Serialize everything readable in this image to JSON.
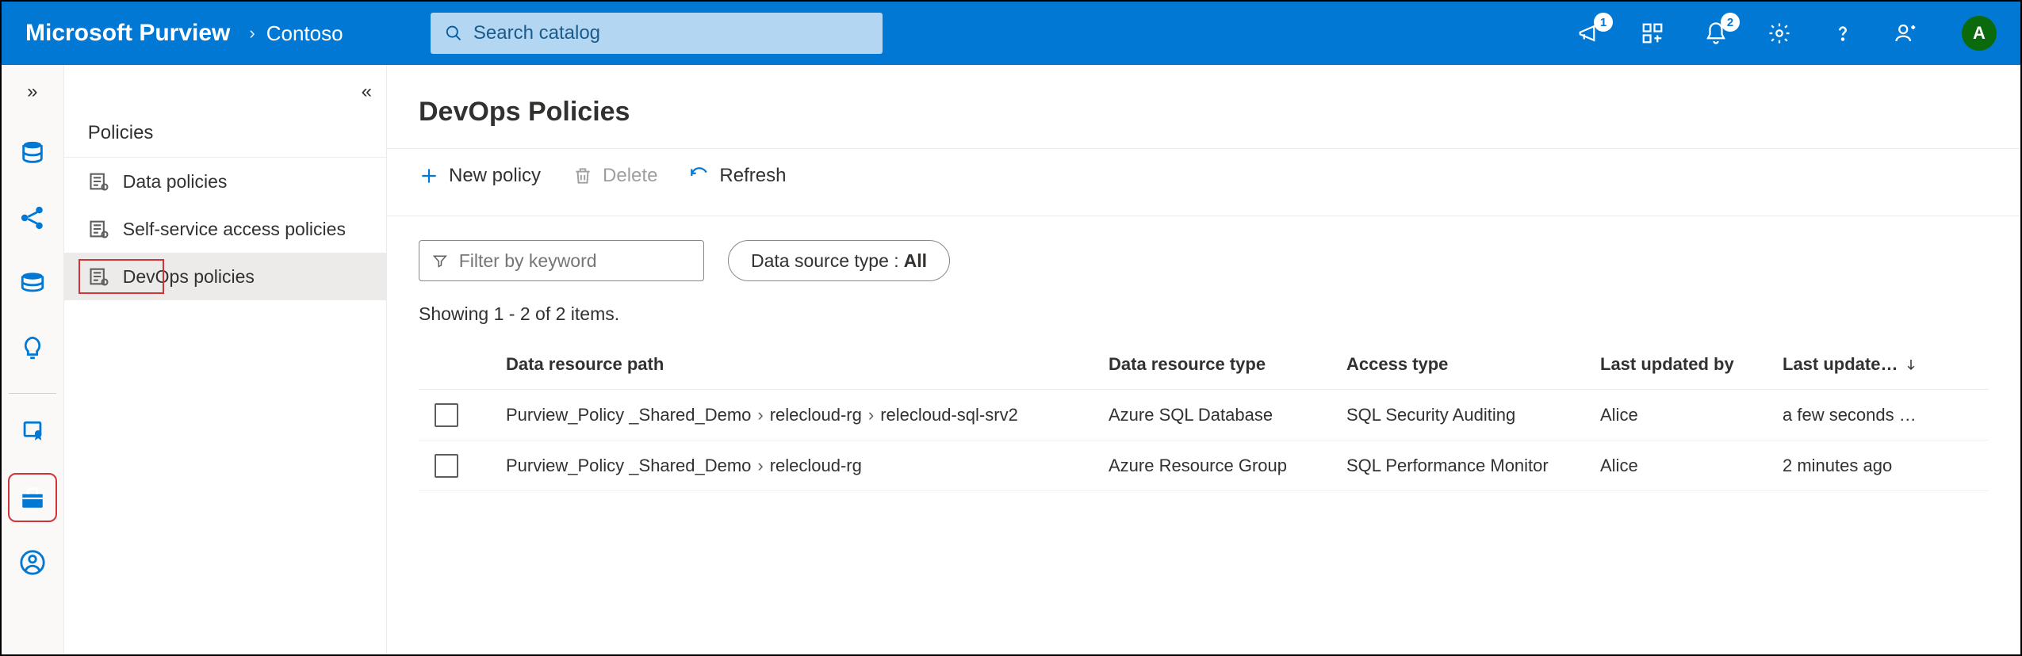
{
  "header": {
    "brand": "Microsoft Purview",
    "crumb": "Contoso",
    "search_placeholder": "Search catalog",
    "badges": {
      "megaphone": "1",
      "bell": "2"
    },
    "avatar_initial": "A"
  },
  "sidepanel": {
    "title": "Policies",
    "items": [
      {
        "label": "Data policies"
      },
      {
        "label": "Self-service access policies"
      },
      {
        "label": "DevOps policies",
        "selected": true
      }
    ]
  },
  "page": {
    "title": "DevOps Policies",
    "toolbar": {
      "new_label": "New policy",
      "delete_label": "Delete",
      "refresh_label": "Refresh"
    },
    "filter_placeholder": "Filter by keyword",
    "datasource_pill_prefix": "Data source type :",
    "datasource_pill_value": "All",
    "count_text": "Showing 1 - 2 of 2 items.",
    "columns": {
      "path": "Data resource path",
      "type": "Data resource type",
      "access": "Access type",
      "updated_by": "Last updated by",
      "updated_on": "Last update…"
    },
    "rows": [
      {
        "path_parts": [
          "Purview_Policy _Shared_Demo",
          "relecloud-rg",
          "relecloud-sql-srv2"
        ],
        "type": "Azure SQL Database",
        "access": "SQL Security Auditing",
        "updated_by": "Alice",
        "updated_on": "a few seconds …"
      },
      {
        "path_parts": [
          "Purview_Policy _Shared_Demo",
          "relecloud-rg"
        ],
        "type": "Azure Resource Group",
        "access": "SQL Performance Monitor",
        "updated_by": "Alice",
        "updated_on": "2 minutes ago"
      }
    ]
  }
}
